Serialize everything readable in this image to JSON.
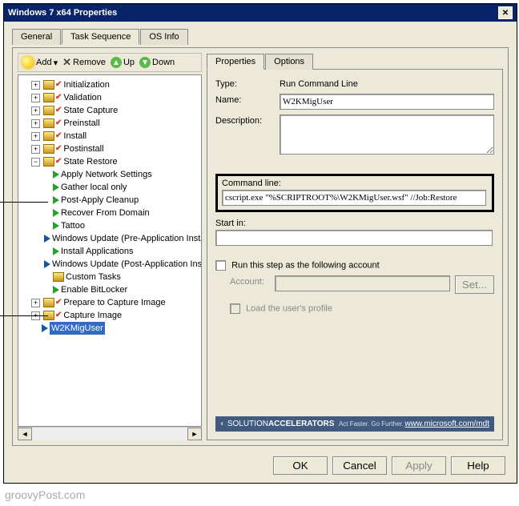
{
  "window": {
    "title": "Windows 7 x64 Properties"
  },
  "outer_tabs": [
    "General",
    "Task Sequence",
    "OS Info"
  ],
  "toolbar": {
    "add": "Add",
    "remove": "Remove",
    "up": "Up",
    "down": "Down"
  },
  "tree": {
    "groups": [
      {
        "label": "Initialization"
      },
      {
        "label": "Validation"
      },
      {
        "label": "State Capture"
      },
      {
        "label": "Preinstall"
      },
      {
        "label": "Install"
      },
      {
        "label": "Postinstall"
      },
      {
        "label": "State Restore"
      }
    ],
    "restore_children": [
      {
        "label": "Apply Network Settings",
        "t": "g"
      },
      {
        "label": "Gather local only",
        "t": "g"
      },
      {
        "label": "Post-Apply Cleanup",
        "t": "g"
      },
      {
        "label": "Recover From Domain",
        "t": "g"
      },
      {
        "label": "Tattoo",
        "t": "g"
      },
      {
        "label": "Windows Update (Pre-Application Installation)",
        "t": "b"
      },
      {
        "label": "Install Applications",
        "t": "g"
      },
      {
        "label": "Windows Update (Post-Application Installation)",
        "t": "b"
      },
      {
        "label": "Custom Tasks",
        "t": "f"
      },
      {
        "label": "Enable BitLocker",
        "t": "g"
      }
    ],
    "after": [
      {
        "label": "Prepare to Capture Image"
      },
      {
        "label": "Capture Image"
      }
    ],
    "selected": "W2KMigUser"
  },
  "inner_tabs": [
    "Properties",
    "Options"
  ],
  "form": {
    "type_label": "Type:",
    "type_value": "Run Command Line",
    "name_label": "Name:",
    "name_value": "W2KMigUser",
    "desc_label": "Description:",
    "cmd_label": "Command line:",
    "cmd_value": "cscript.exe \"%SCRIPTROOT%\\W2KMigUser.wsf\" //Job:Restore",
    "start_label": "Start in:",
    "runas_label": "Run this step as the following account",
    "account_label": "Account:",
    "set_btn": "Set...",
    "load_profile": "Load the user's profile"
  },
  "footer": {
    "brand1": "SOLUTION",
    "brand2": "ACCELERATORS",
    "tag": "Act Faster. Go Further.",
    "link": "www.microsoft.com/mdt"
  },
  "buttons": {
    "ok": "OK",
    "cancel": "Cancel",
    "apply": "Apply",
    "help": "Help"
  },
  "watermark": "groovyPost.com"
}
